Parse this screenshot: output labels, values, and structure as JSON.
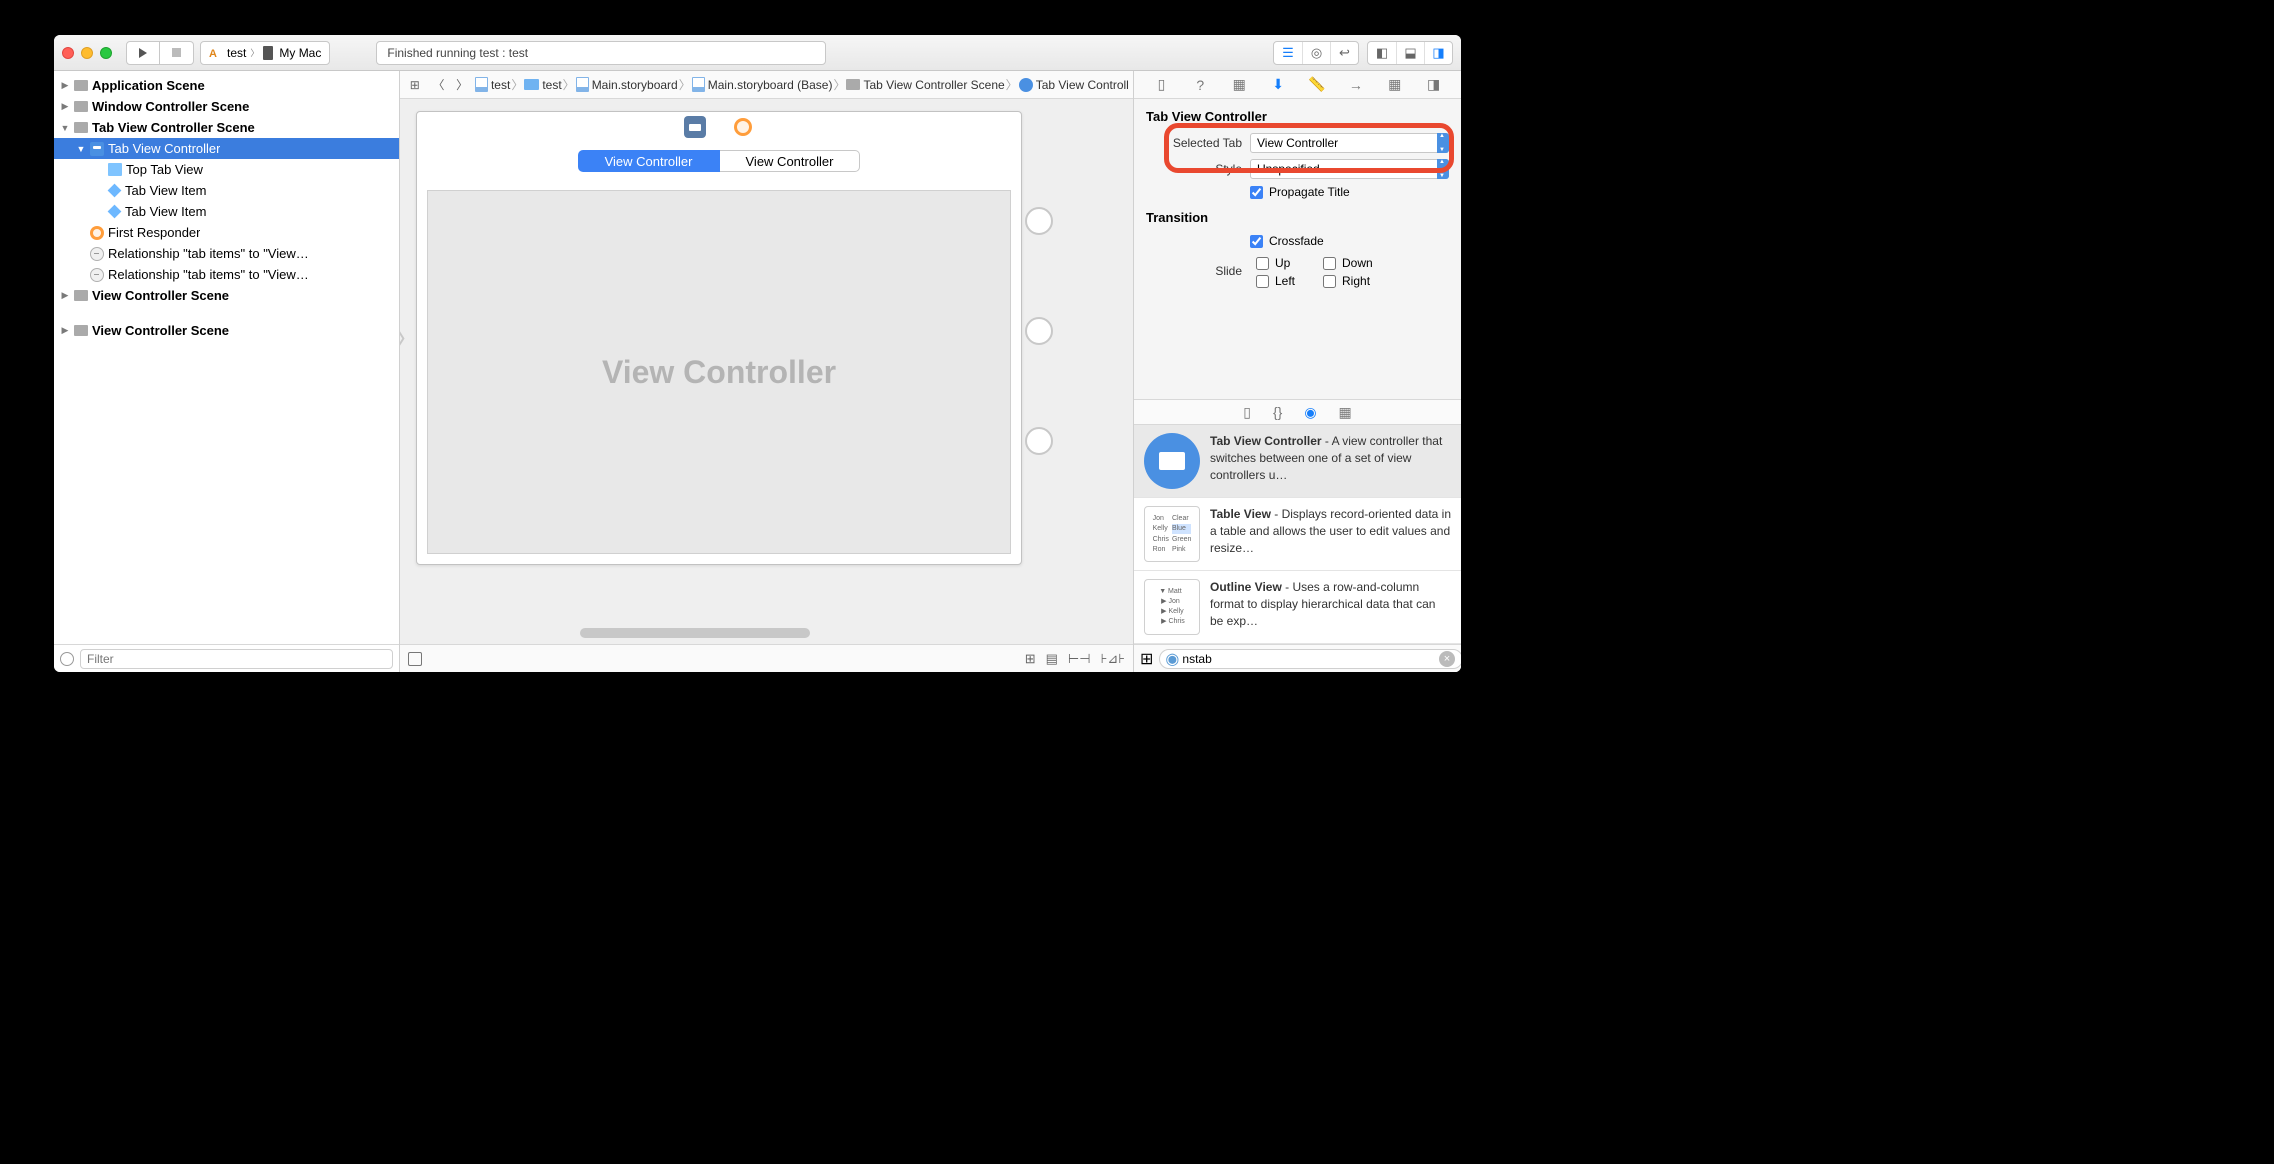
{
  "toolbar": {
    "scheme_name": "test",
    "destination": "My Mac",
    "status": "Finished running test : test"
  },
  "breadcrumbs": [
    {
      "icon": "file",
      "label": "test"
    },
    {
      "icon": "folder",
      "label": "test"
    },
    {
      "icon": "file",
      "label": "Main.storyboard"
    },
    {
      "icon": "file",
      "label": "Main.storyboard (Base)"
    },
    {
      "icon": "scene",
      "label": "Tab View Controller Scene"
    },
    {
      "icon": "vc-round",
      "label": "Tab View Controller"
    }
  ],
  "outline": [
    {
      "level": 0,
      "disc": "right",
      "icon": "scene",
      "bold": true,
      "label": "Application Scene"
    },
    {
      "level": 0,
      "disc": "right",
      "icon": "scene",
      "bold": true,
      "label": "Window Controller Scene"
    },
    {
      "level": 0,
      "disc": "down",
      "icon": "scene",
      "bold": true,
      "label": "Tab View Controller Scene"
    },
    {
      "level": 1,
      "disc": "down",
      "icon": "vc",
      "bold": false,
      "selected": true,
      "label": "Tab View Controller"
    },
    {
      "level": 2,
      "disc": "",
      "icon": "tv",
      "label": "Top Tab View"
    },
    {
      "level": 2,
      "disc": "",
      "icon": "cube",
      "label": "Tab View Item"
    },
    {
      "level": 2,
      "disc": "",
      "icon": "cube",
      "label": "Tab View Item"
    },
    {
      "level": 1,
      "disc": "",
      "icon": "fr",
      "label": "First Responder"
    },
    {
      "level": 1,
      "disc": "",
      "icon": "rel",
      "label": "Relationship \"tab items\" to \"View…"
    },
    {
      "level": 1,
      "disc": "",
      "icon": "rel",
      "label": "Relationship \"tab items\" to \"View…"
    },
    {
      "level": 0,
      "disc": "right",
      "icon": "scene",
      "bold": true,
      "label": "View Controller Scene"
    },
    {
      "spacer": true
    },
    {
      "level": 0,
      "disc": "right",
      "icon": "scene",
      "bold": true,
      "label": "View Controller Scene"
    }
  ],
  "filter_placeholder": "Filter",
  "canvas": {
    "tab1": "View Controller",
    "tab2": "View Controller",
    "content_title": "View Controller"
  },
  "inspector": {
    "section_title": "Tab View Controller",
    "selected_tab_label": "Selected Tab",
    "selected_tab_value": "View Controller",
    "style_label": "Style",
    "style_value": "Unspecified",
    "propagate_label": "Propagate Title",
    "transition_title": "Transition",
    "crossfade": "Crossfade",
    "slide_label": "Slide",
    "up": "Up",
    "down": "Down",
    "left": "Left",
    "right": "Right"
  },
  "library": {
    "items": [
      {
        "title": "Tab View Controller",
        "desc": " - A view controller that switches between one of a set of view controllers u…",
        "selected": true,
        "icon": "circle"
      },
      {
        "title": "Table View",
        "desc": " - Displays record-oriented data in a table and allows the user to edit values and resize…",
        "icon": "table"
      },
      {
        "title": "Outline View",
        "desc": " - Uses a row-and-column format to display hierarchical data that can be exp…",
        "icon": "outline"
      }
    ],
    "search": "nstab"
  }
}
